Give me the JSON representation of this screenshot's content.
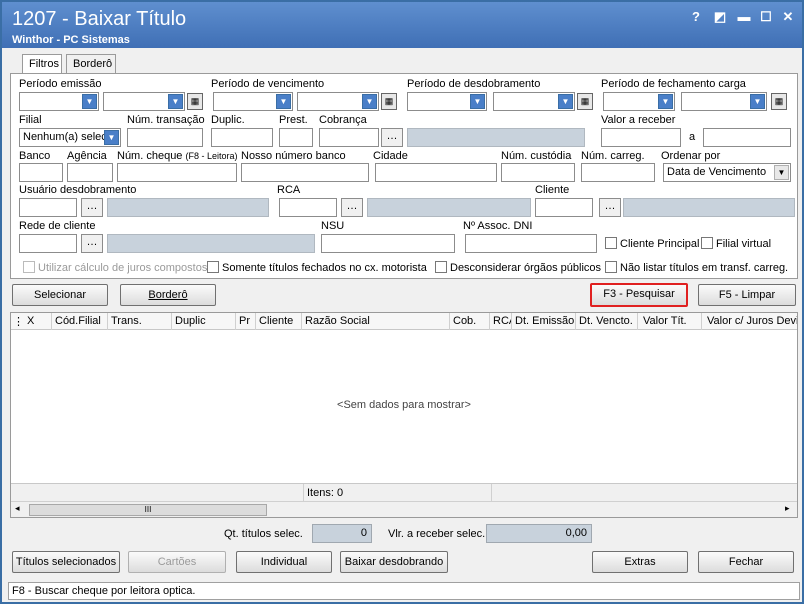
{
  "window": {
    "title": "1207 - Baixar Título",
    "subtitle": "Winthor - PC Sistemas",
    "controls": [
      "?",
      "◩",
      "▬",
      "☐",
      "✕"
    ]
  },
  "tabs": [
    {
      "label": "Filtros",
      "active": true
    },
    {
      "label": "Borderô",
      "active": false
    }
  ],
  "filters": {
    "periodo_emissao": "Período emissão",
    "periodo_vencimento": "Período de vencimento",
    "periodo_desdobramento": "Período de desdobramento",
    "periodo_fechamento": "Período de fechamento carga",
    "filial": "Filial",
    "filial_value": "Nenhum(a) selec",
    "num_transacao": "Núm. transação",
    "duplic": "Duplic.",
    "prest": "Prest.",
    "cobranca": "Cobrança",
    "valor_receber": "Valor a receber",
    "a": "a",
    "banco": "Banco",
    "agencia": "Agência",
    "num_cheque": "Núm. cheque",
    "num_cheque_hint": "(F8 - Leitora)",
    "nosso_numero": "Nosso número banco",
    "cidade": "Cidade",
    "num_custodia": "Núm. custódia",
    "num_carreg": "Núm. carreg.",
    "ordenar_por": "Ordenar por",
    "ordenar_value": "Data de Vencimento",
    "usuario_desdobramento": "Usuário desdobramento",
    "rca": "RCA",
    "cliente": "Cliente",
    "rede_cliente": "Rede de cliente",
    "nsu": "NSU",
    "assoc_dni": "Nº Assoc. DNI",
    "cliente_principal": "Cliente Principal",
    "filial_virtual": "Filial virtual",
    "juros_compostos": "Utilizar cálculo de juros compostos",
    "somente_fechados": "Somente títulos fechados no cx. motorista",
    "desconsiderar_orgaos": "Desconsiderar órgãos públicos",
    "nao_listar": "Não listar títulos em transf. carreg."
  },
  "action_buttons": {
    "selecionar": "Selecionar",
    "bordero": "Borderô",
    "pesquisar": "F3 - Pesquisar",
    "limpar": "F5 - Limpar"
  },
  "grid": {
    "columns": [
      "X",
      "Cód.Filial",
      "Trans.",
      "Duplic",
      "Pr",
      "Cliente",
      "Razão Social",
      "Cob.",
      "RCA",
      "Dt. Emissão",
      "Dt. Vencto.",
      "Valor Tít.",
      "Valor c/ Juros Devido"
    ],
    "empty_text": "<Sem dados para mostrar>",
    "items_label": "Itens: 0",
    "thumb_grip": "III"
  },
  "summary": {
    "qt_titulos_label": "Qt. títulos selec.",
    "qt_titulos_value": "0",
    "vlr_receber_label": "Vlr. a receber selec.",
    "vlr_receber_value": "0,00"
  },
  "bottom_buttons": {
    "titulos_selecionados": "Títulos selecionados",
    "cartoes": "Cartões",
    "individual": "Individual",
    "baixar_desdobrando": "Baixar desdobrando",
    "extras": "Extras",
    "fechar": "Fechar"
  },
  "status_bar": "F8 - Buscar cheque por leitora optica."
}
